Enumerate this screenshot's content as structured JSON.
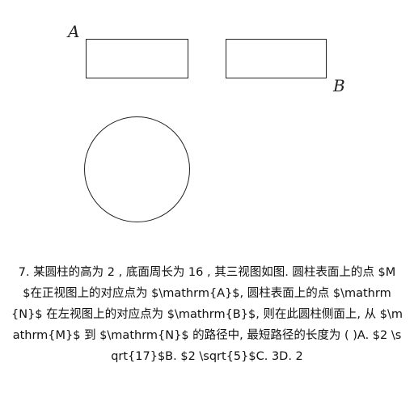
{
  "figure": {
    "labels": {
      "a": "A",
      "b": "B"
    },
    "stroke_color": "#222222"
  },
  "question": {
    "text": "7. 某圆柱的高为 2 , 底面周长为 16 , 其三视图如图. 圆柱表面上的点 $M$在正视图上的对应点为 $\\mathrm{A}$, 圆柱表面上的点 $\\mathrm{N}$ 在左视图上的对应点为 $\\mathrm{B}$, 则在此圆柱侧面上, 从 $\\mathrm{M}$ 到 $\\mathrm{N}$ 的路径中, 最短路径的长度为 ( )A. $2 \\sqrt{17}$B. $2 \\sqrt{5}$C. 3D. 2"
  }
}
